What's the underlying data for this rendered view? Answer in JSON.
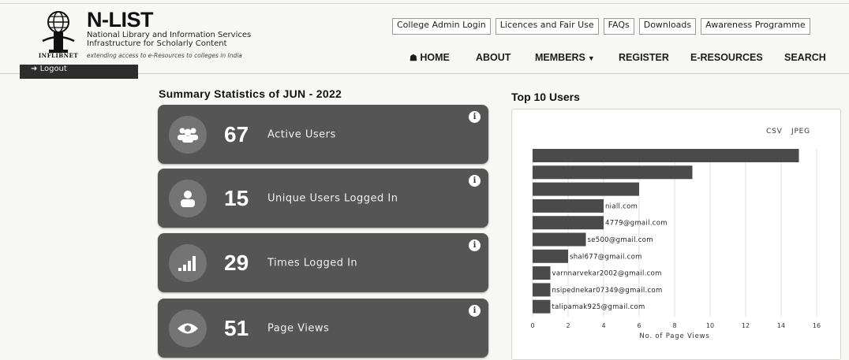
{
  "brand": {
    "logo_caption": "INFLIBNET",
    "title": "N-LIST",
    "subtitle_1": "National Library and Information Services",
    "subtitle_2": "Infrastructure for Scholarly Content",
    "tagline": "extending access to e-Resources to colleges in India"
  },
  "top_links": [
    "College Admin Login",
    "Licences and Fair Use",
    "FAQs",
    "Downloads",
    "Awareness Programme"
  ],
  "nav": {
    "home": "HOME",
    "about": "ABOUT",
    "members": "MEMBERS",
    "register": "REGISTER",
    "eresources": "E-RESOURCES",
    "search": "SEARCH"
  },
  "sidebar": {
    "logout": "Logout"
  },
  "summary": {
    "title": "Summary Statistics of JUN - 2022",
    "cards": [
      {
        "icon": "users-icon",
        "value": "67",
        "label": "Active Users"
      },
      {
        "icon": "user-icon",
        "value": "15",
        "label": "Unique Users Logged In"
      },
      {
        "icon": "signal-bars-icon",
        "value": "29",
        "label": "Times Logged In"
      },
      {
        "icon": "eye-icon",
        "value": "51",
        "label": "Page Views"
      }
    ]
  },
  "top_users": {
    "title": "Top 10 Users",
    "export_csv": "CSV",
    "export_jpeg": "JPEG"
  },
  "chart_data": {
    "type": "bar",
    "orientation": "horizontal",
    "title": "",
    "xlabel": "No. of Page Views",
    "ylabel": "",
    "xlim": [
      0,
      16
    ],
    "xticks": [
      0,
      2,
      4,
      6,
      8,
      10,
      12,
      14,
      16
    ],
    "grid": true,
    "categories": [
      "",
      "",
      "",
      "niall.com",
      "4779@gmail.com",
      "se500@gmail.com",
      "shal677@gmail.com",
      "varnnarvekar2002@gmail.com",
      "nsipednekar07349@gmail.com",
      "talipamak925@gmail.com"
    ],
    "values": [
      15,
      9,
      6,
      4,
      4,
      3,
      2,
      1,
      1,
      1
    ],
    "bar_color": "#4a4a4a"
  }
}
